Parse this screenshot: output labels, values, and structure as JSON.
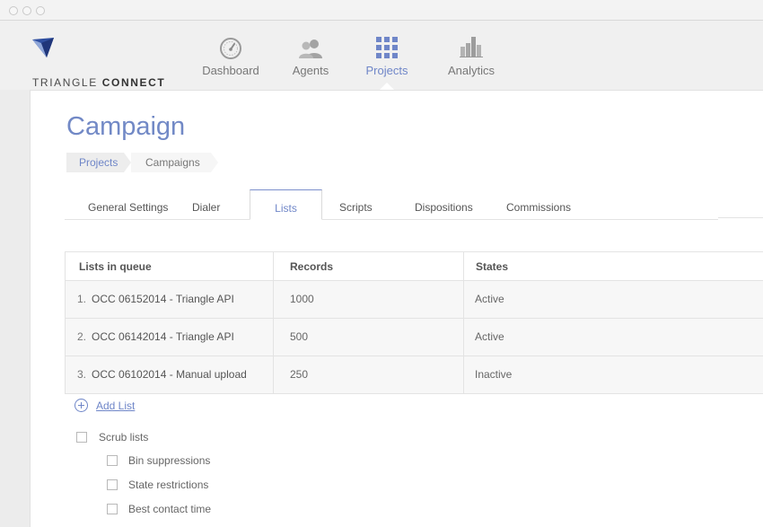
{
  "app": {
    "brand_light": "TRIANGLE ",
    "brand_bold": "CONNECT"
  },
  "nav": {
    "items": [
      {
        "label": "Dashboard",
        "icon": "dashboard-gauge-icon"
      },
      {
        "label": "Agents",
        "icon": "agents-icon"
      },
      {
        "label": "Projects",
        "icon": "projects-grid-icon",
        "active": true
      },
      {
        "label": "Analytics",
        "icon": "analytics-bar-icon"
      }
    ]
  },
  "page": {
    "title": "Campaign"
  },
  "breadcrumb": {
    "items": [
      "Projects",
      "Campaigns"
    ]
  },
  "tabs": {
    "items": [
      "General Settings",
      "Dialer",
      "Lists",
      "Scripts",
      "Dispositions",
      "Commissions"
    ],
    "active": "Lists"
  },
  "table": {
    "headers": [
      "Lists in queue",
      "Records",
      "States"
    ],
    "rows": [
      {
        "num": "1.",
        "name": "OCC 06152014 - Triangle API",
        "records": "1000",
        "state": "Active"
      },
      {
        "num": "2.",
        "name": "OCC 06142014 - Triangle API",
        "records": "500",
        "state": "Active"
      },
      {
        "num": "3.",
        "name": "OCC 06102014 - Manual upload",
        "records": "250",
        "state": "Inactive"
      }
    ]
  },
  "add_list": {
    "label": "Add List"
  },
  "scrub": {
    "label": "Scrub lists",
    "options": [
      "Bin suppressions",
      "State restrictions",
      "Best contact time"
    ]
  },
  "colors": {
    "accent": "#6f86c8",
    "title": "#7289c6"
  }
}
